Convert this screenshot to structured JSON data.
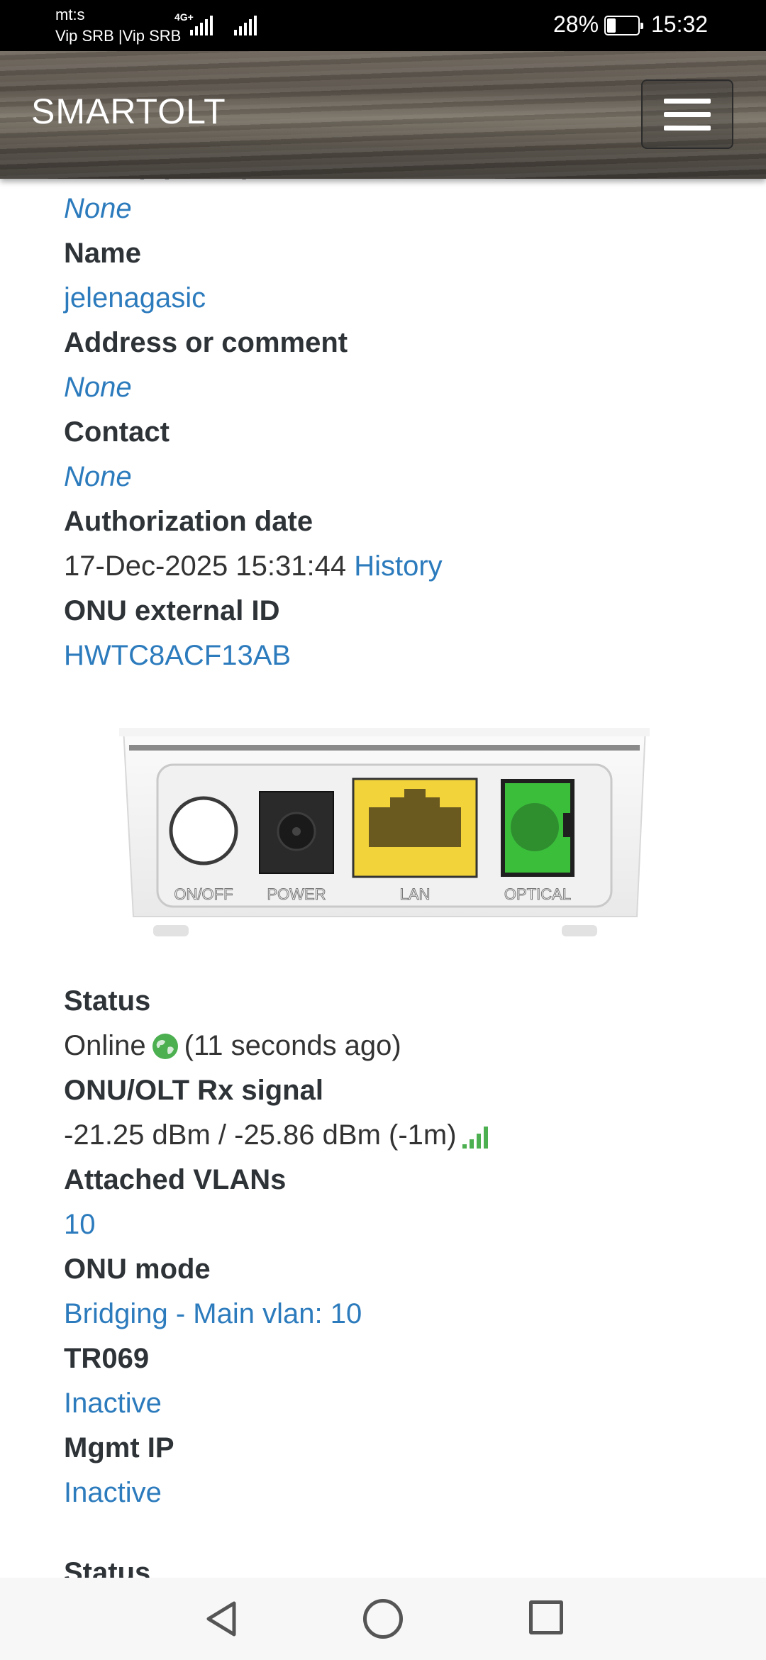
{
  "status_bar": {
    "carrier_top": "mt:s",
    "carrier_bottom": "Vip SRB |Vip SRB",
    "network_type": "4G+",
    "battery_percent": "28%",
    "battery_level": 0.28,
    "time": "15:32"
  },
  "header": {
    "brand": "SMARTOLT",
    "menu_icon": "hamburger-menu-icon"
  },
  "details": {
    "odb_label": "ODB (Splitter)",
    "odb_value": "None",
    "name_label": "Name",
    "name_value": "jelenagasic",
    "address_label": "Address or comment",
    "address_value": "None",
    "contact_label": "Contact",
    "contact_value": "None",
    "auth_date_label": "Authorization date",
    "auth_date_value": "17-Dec-2025 15:31:44",
    "auth_history_link": "History",
    "external_id_label": "ONU external ID",
    "external_id_value": "HWTC8ACF13AB"
  },
  "device_image": {
    "ports": [
      "ON/OFF",
      "POWER",
      "LAN",
      "OPTICAL"
    ]
  },
  "status_info": {
    "status_label": "Status",
    "status_value": "Online",
    "status_icon": "globe-icon",
    "status_since": "(11 seconds ago)",
    "signal_label": "ONU/OLT Rx signal",
    "signal_value": "-21.25 dBm / -25.86 dBm (-1m)",
    "signal_icon": "signal-bars-icon",
    "vlans_label": "Attached VLANs",
    "vlans_value": "10",
    "mode_label": "ONU mode",
    "mode_value": "Bridging - Main vlan: 10",
    "tr069_label": "TR069",
    "tr069_value": "Inactive",
    "mgmt_ip_label": "Mgmt IP",
    "mgmt_ip_value": "Inactive",
    "next_section_label": "Status"
  },
  "colors": {
    "link": "#2c7bbd",
    "label": "#2e3338",
    "online_green": "#4caf50",
    "lan_yellow": "#f2d33a",
    "optical_green": "#3bbf3b"
  }
}
